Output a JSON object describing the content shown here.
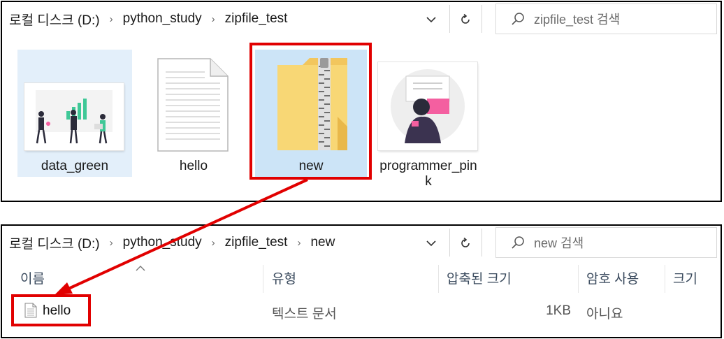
{
  "top_window": {
    "breadcrumb": [
      "로컬 디스크 (D:)",
      "python_study",
      "zipfile_test"
    ],
    "search_placeholder": "zipfile_test 검색",
    "files": [
      {
        "name": "data_green",
        "icon": "image-thumbnail"
      },
      {
        "name": "hello",
        "icon": "text-document-icon"
      },
      {
        "name": "new",
        "icon": "zip-folder-icon"
      },
      {
        "name_line1": "programmer_pin",
        "name_line2": "k",
        "icon": "image-thumbnail"
      }
    ]
  },
  "bottom_window": {
    "breadcrumb": [
      "로컬 디스크 (D:)",
      "python_study",
      "zipfile_test",
      "new"
    ],
    "search_placeholder": "new 검색",
    "columns": [
      "이름",
      "유형",
      "압축된 크기",
      "암호 사용",
      "크기"
    ],
    "rows": [
      {
        "name": "hello",
        "type": "텍스트 문서",
        "compressed_size": "1KB",
        "password": "아니요",
        "size": ""
      }
    ]
  },
  "colors": {
    "highlight": "#e10000",
    "selection": "#cce4f7",
    "selection_light": "#e3effa",
    "thumb_green": "#3fc897",
    "thumb_pink": "#f45fa0"
  },
  "annotation": {
    "type": "red-arrow",
    "from": "new",
    "to": "hello"
  }
}
